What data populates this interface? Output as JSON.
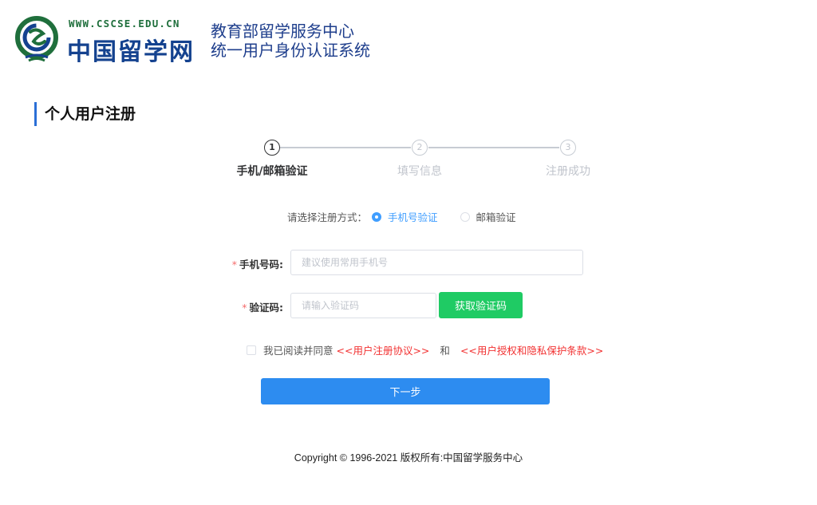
{
  "header": {
    "logo_url": "WWW.CSCSE.EDU.CN",
    "logo_name": "中国留学网",
    "system_line1": "教育部留学服务中心",
    "system_line2": "统一用户身份认证系统",
    "logo_icon": "cscse-emblem-icon",
    "colors": {
      "logo_green": "#1f6f3c",
      "logo_blue": "#14428f"
    }
  },
  "page_title": "个人用户注册",
  "steps": [
    {
      "number": "1",
      "label": "手机/邮箱验证",
      "state": "active"
    },
    {
      "number": "2",
      "label": "填写信息",
      "state": "inactive"
    },
    {
      "number": "3",
      "label": "注册成功",
      "state": "inactive"
    }
  ],
  "method": {
    "label": "请选择注册方式：",
    "options": [
      {
        "label": "手机号验证",
        "selected": true
      },
      {
        "label": "邮箱验证",
        "selected": false
      }
    ]
  },
  "form": {
    "required_mark": "*",
    "phone": {
      "label": "手机号码:",
      "value": "",
      "placeholder": "建议使用常用手机号"
    },
    "code": {
      "label": "验证码:",
      "value": "",
      "placeholder": "请输入验证码",
      "button": "获取验证码"
    }
  },
  "agreement": {
    "checked": false,
    "prefix": "我已阅读并同意",
    "link1": "<<用户注册协议>>",
    "and": "和",
    "link2": "<<用户授权和隐私保护条款>>"
  },
  "next_button": "下一步",
  "footer": "Copyright © 1996-2021 版权所有:中国留学服务中心",
  "colors": {
    "primary": "#2d8cf0",
    "green_button": "#1fcb64",
    "link_red": "#f23030",
    "radio_blue": "#409eff",
    "title_bar": "#2b6fd6"
  }
}
